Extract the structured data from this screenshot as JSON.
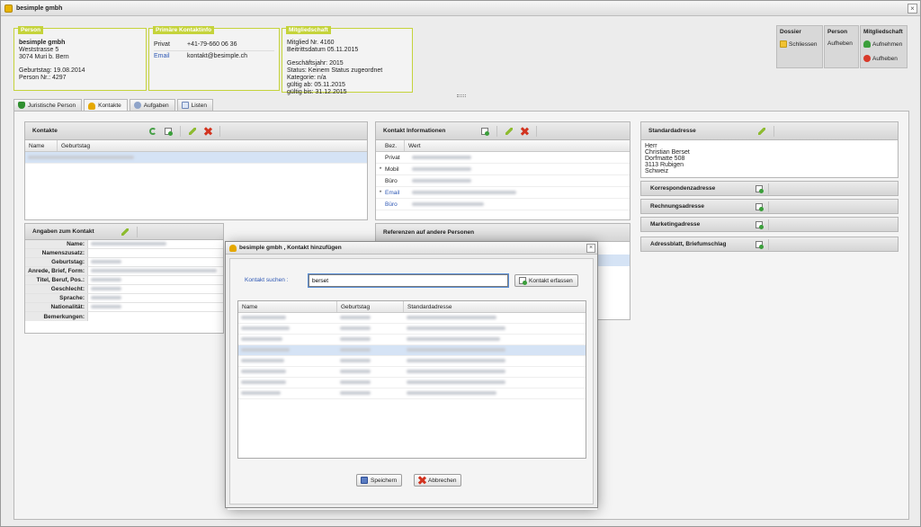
{
  "window": {
    "title": "besimple gmbh",
    "close": "×"
  },
  "person": {
    "legend": "Person",
    "name": "besimple gmbh",
    "street": "Weststrasse 5",
    "city": "3074 Muri b. Bern",
    "birthday": "Geburtstag: 19.08.2014",
    "person_no": "Person Nr.: 4297"
  },
  "contact": {
    "legend": "Primäre Kontaktinfo",
    "rows": [
      {
        "key": "Privat",
        "value": "+41-79-660 06 36"
      },
      {
        "key": "Email",
        "value": "kontakt@besimple.ch"
      }
    ]
  },
  "membership": {
    "legend": "Mitgliedschaft",
    "lines1": [
      "Mitglied Nr. 4160",
      "Beitrittsdatum 05.11.2015"
    ],
    "lines2": [
      "Geschäftsjahr: 2015",
      "Status: Keinem Status zugeordnet",
      "Kategorie: n/a",
      "gültig ab: 05.11.2015",
      "gültig bis: 31.12.2015"
    ]
  },
  "actions": {
    "dossier": {
      "head": "Dossier",
      "btn": "Schliessen"
    },
    "person": {
      "head": "Person",
      "btn": "Aufheben"
    },
    "mitgliedschaft": {
      "head": "Mitgliedschaft",
      "btn1": "Aufnehmen",
      "btn2": "Aufheben"
    }
  },
  "tabs": [
    "Juristische Person",
    "Kontakte",
    "Aufgaben",
    "Listen"
  ],
  "kontakte": {
    "title": "Kontakte",
    "cols": [
      "Name",
      "Geburtstag"
    ]
  },
  "angaben": {
    "title": "Angaben zum Kontakt",
    "labels": [
      "Name:",
      "Namenszusatz:",
      "Geburtstag:",
      "Anrede, Brief, Form:",
      "Titel, Beruf, Pos.:",
      "Geschlecht:",
      "Sprache:",
      "Nationalität:",
      "Bemerkungen:"
    ]
  },
  "kontaktinfo": {
    "title": "Kontakt Informationen",
    "cols": [
      "Bez.",
      "Wert"
    ],
    "rows": [
      {
        "bez": "Privat",
        "star": ""
      },
      {
        "bez": "Mobil",
        "star": "*"
      },
      {
        "bez": "Büro",
        "star": ""
      },
      {
        "bez": "Email",
        "star": "*"
      },
      {
        "bez": "Büro",
        "star": ""
      }
    ]
  },
  "referenzen": {
    "title": "Referenzen auf andere Personen"
  },
  "standard": {
    "title": "Standardadresse",
    "lines": [
      "Herr",
      "Christian Berset",
      "Dorfmatte 508",
      "3113 Rubigen",
      "Schweiz"
    ]
  },
  "addrbars": [
    "Korrespondenzadresse",
    "Rechnungsadresse",
    "Marketingadresse",
    "Adressblatt, Briefumschlag"
  ],
  "dialog": {
    "title": "besimple gmbh , Kontakt hinzufügen",
    "close": "×",
    "search_label": "Kontakt suchen :",
    "search_value": "berset",
    "create_btn": "Kontakt erfassen",
    "cols": [
      "Name",
      "Geburtstag",
      "Standardadresse"
    ],
    "save_btn": "Speichern",
    "cancel_btn": "Abbrechen"
  }
}
